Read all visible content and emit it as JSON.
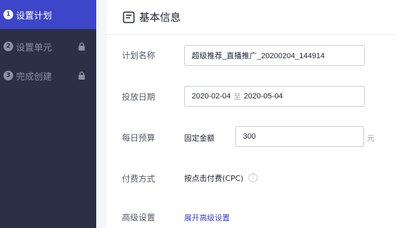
{
  "sidebar": {
    "steps": [
      {
        "num": "1",
        "label": "设置计划",
        "active": true,
        "locked": false
      },
      {
        "num": "2",
        "label": "设置单元",
        "active": false,
        "locked": true
      },
      {
        "num": "3",
        "label": "完成创建",
        "active": false,
        "locked": true
      }
    ]
  },
  "section": {
    "title": "基本信息"
  },
  "form": {
    "plan_name": {
      "label": "计划名称",
      "value": "超级推荐_直播推广_20200204_144914"
    },
    "date_range": {
      "label": "投放日期",
      "start": "2020-02-04",
      "separator": "至",
      "end": "2020-05-04"
    },
    "daily_budget": {
      "label": "每日预算",
      "type": "固定金额",
      "value": "300",
      "unit": "元"
    },
    "payment": {
      "label": "付费方式",
      "value": "按点击付费(CPC)",
      "help": "?"
    },
    "advanced": {
      "label": "高级设置",
      "link": "展开高级设置"
    }
  },
  "colors": {
    "sidebar_bg": "#2b3046",
    "active_step": "#3d45c9",
    "link": "#3d45c9"
  }
}
